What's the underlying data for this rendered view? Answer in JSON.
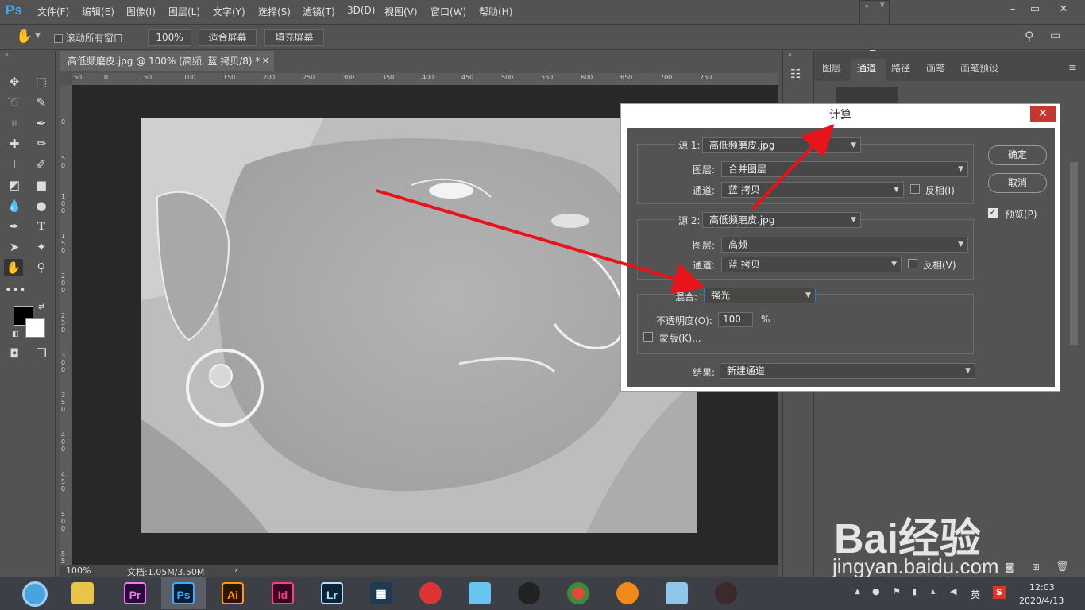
{
  "app": {
    "logo": "Ps"
  },
  "menu": [
    "文件(F)",
    "编辑(E)",
    "图像(I)",
    "图层(L)",
    "文字(Y)",
    "选择(S)",
    "滤镜(T)",
    "3D(D)",
    "视图(V)",
    "窗口(W)",
    "帮助(H)"
  ],
  "options": {
    "scroll_all": "滚动所有窗口",
    "zoom": "100%",
    "fit_screen": "适合屏幕",
    "fill_screen": "填充屏幕"
  },
  "document": {
    "tab_title": "高低频磨皮.jpg @ 100% (高频, 蓝 拷贝/8) *",
    "ruler_top": [
      "50",
      "0",
      "50",
      "100",
      "150",
      "200",
      "250",
      "300",
      "350",
      "400",
      "450",
      "500",
      "550",
      "600",
      "650",
      "700",
      "750"
    ],
    "ruler_left": [
      "0",
      "5 0",
      "1 0 0",
      "1 5 0",
      "2 0 0",
      "2 5 0",
      "3 0 0",
      "3 5 0",
      "4 0 0",
      "4 5 0",
      "5 0 0",
      "5 5 0"
    ],
    "status_zoom": "100%",
    "status_doc": "文档:1.05M/3.50M"
  },
  "panel": {
    "tabs": [
      "图层",
      "通道",
      "路径",
      "画笔",
      "画笔预设"
    ],
    "active_tab": "通道"
  },
  "dialog": {
    "title": "计算",
    "source1_label": "源 1:",
    "source1_file": "高低频磨皮.jpg",
    "source1_layer_label": "图层:",
    "source1_layer": "合并图层",
    "source1_channel_label": "通道:",
    "source1_channel": "蓝 拷贝",
    "source1_invert": "反相(I)",
    "source2_label": "源 2:",
    "source2_file": "高低频磨皮.jpg",
    "source2_layer_label": "图层:",
    "source2_layer": "高频",
    "source2_channel_label": "通道:",
    "source2_channel": "蓝 拷贝",
    "source2_invert": "反相(V)",
    "blend_label": "混合:",
    "blend": "强光",
    "opacity_label": "不透明度(O):",
    "opacity": "100",
    "opacity_unit": "%",
    "mask_label": "蒙版(K)...",
    "result_label": "结果:",
    "result": "新建通道",
    "ok": "确定",
    "cancel": "取消",
    "preview": "预览(P)"
  },
  "taskbar": {
    "apps": [
      "Pr",
      "Ps",
      "Ai",
      "Id",
      "Lr"
    ],
    "tray_ime": "英",
    "time": "12:03",
    "date": "2020/4/13"
  },
  "watermark": {
    "brand": "Bai经验",
    "url": "jingyan.baidu.com"
  },
  "colors": {
    "ps_blue": "#3fa9f5",
    "arrow_red": "#e8141a",
    "close_red": "#c7362f"
  }
}
